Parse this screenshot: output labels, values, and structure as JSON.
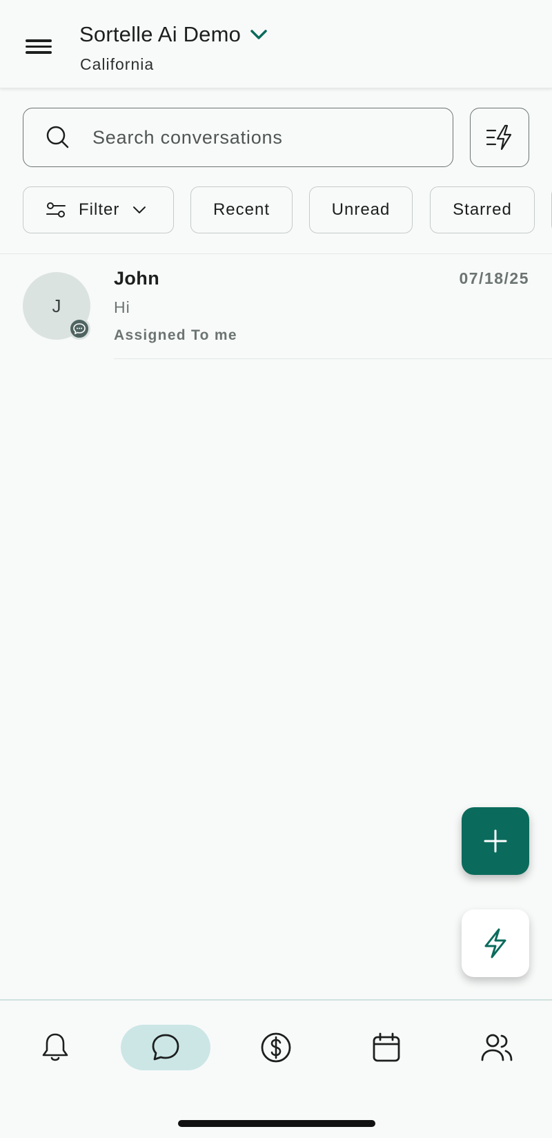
{
  "header": {
    "title": "Sortelle Ai Demo",
    "subtitle": "California",
    "menu_icon": "hamburger-menu-icon",
    "title_chevron_icon": "chevron-down-icon"
  },
  "search": {
    "placeholder": "Search conversations",
    "value": "",
    "icon": "search-icon",
    "quick_action_icon": "bolt-list-icon"
  },
  "chips": {
    "filter_label": "Filter",
    "recent_label": "Recent",
    "unread_label": "Unread",
    "starred_label": "Starred"
  },
  "conversations": [
    {
      "initial": "J",
      "name": "John",
      "date": "07/18/25",
      "message": "Hi",
      "assignment": "Assigned To me",
      "channel_icon": "chat-bubble-icon"
    }
  ],
  "fabs": {
    "add_icon": "plus-icon",
    "bolt_icon": "bolt-icon"
  },
  "bottom_nav": {
    "items": [
      "bell-icon",
      "chat-icon",
      "dollar-icon",
      "calendar-icon",
      "contacts-icon"
    ],
    "active": "chat-icon"
  },
  "colors": {
    "accent": "#0a6b5c",
    "active_nav_bg": "#cce6e6",
    "background": "#f8faf9"
  }
}
